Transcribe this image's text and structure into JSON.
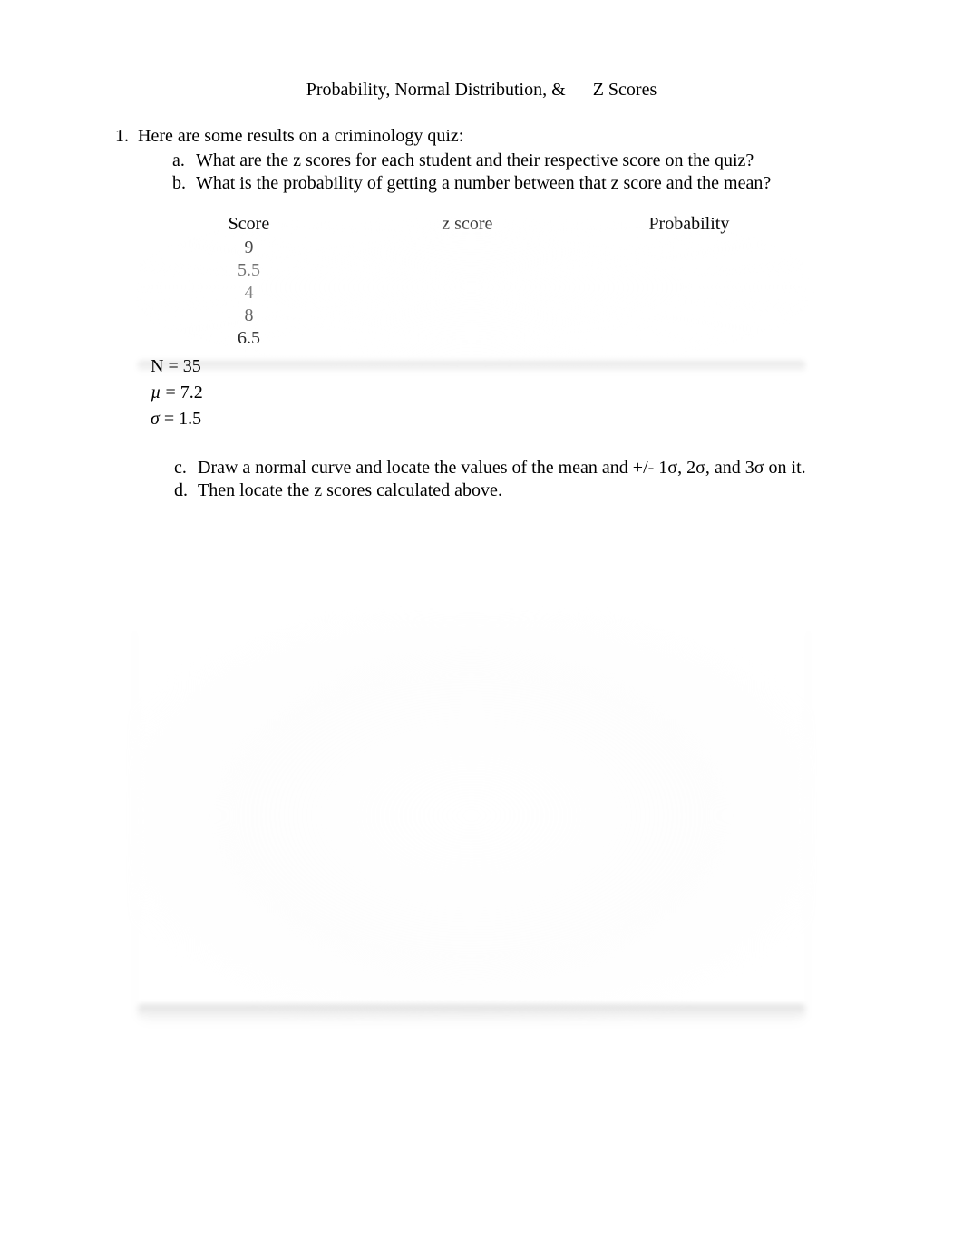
{
  "title_left": "Probability, Normal Distribution, &",
  "title_right": "Z Scores",
  "q1": {
    "number": "1.",
    "stem": "Here are some results on a criminology quiz:",
    "a_letter": "a.",
    "a_text": "What are the z scores for each student and their respective score on the quiz?",
    "b_letter": "b.",
    "b_text": "What is the probability of getting a number between that z score and the mean?",
    "c_letter": "c.",
    "c_text": "Draw a normal curve and locate the values of the mean and +/- 1σ, 2σ, and 3σ on it.",
    "d_letter": "d.",
    "d_text": "Then locate the z scores calculated above."
  },
  "table": {
    "headers": {
      "score": "Score",
      "z": "z score",
      "prob": "Probability"
    },
    "rows": [
      {
        "score": "9",
        "z": "",
        "prob": ""
      },
      {
        "score": "5.5",
        "z": "",
        "prob": ""
      },
      {
        "score": "4",
        "z": "",
        "prob": ""
      },
      {
        "score": "8",
        "z": "",
        "prob": ""
      },
      {
        "score": "6.5",
        "z": "",
        "prob": ""
      }
    ]
  },
  "stats": {
    "n_label": "N = 35",
    "mu_symbol": "µ",
    "mu_rest": " = 7.2",
    "sigma_symbol": "σ",
    "sigma_rest": " = 1.5"
  }
}
